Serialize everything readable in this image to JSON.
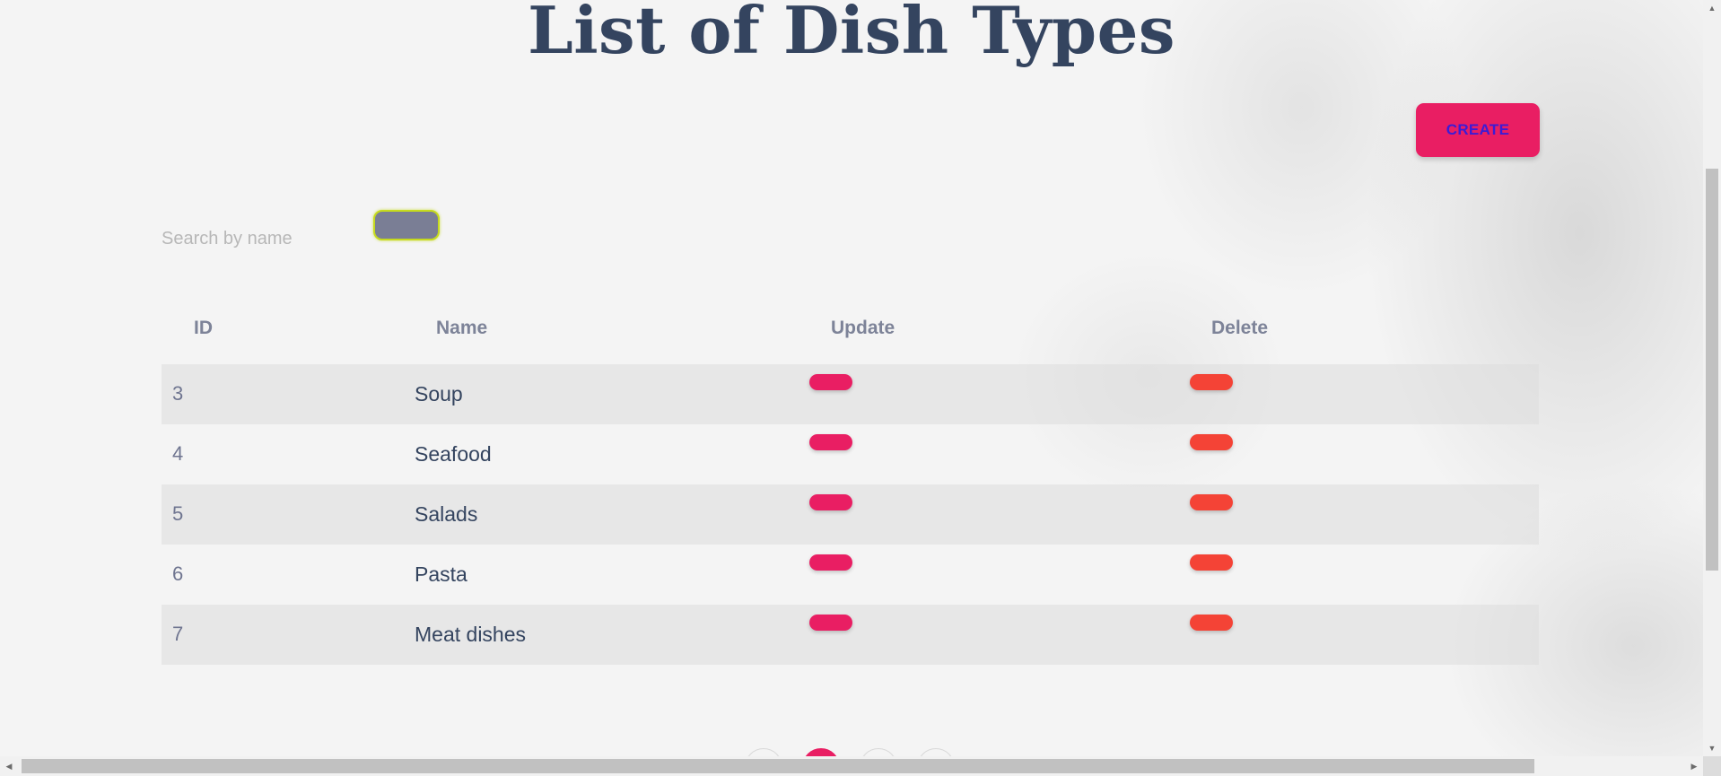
{
  "page": {
    "title": "List of Dish Types"
  },
  "toolbar": {
    "create_label": "CREATE"
  },
  "search": {
    "placeholder": "Search by name",
    "value": ""
  },
  "table": {
    "headers": {
      "id": "ID",
      "name": "Name",
      "update": "Update",
      "delete": "Delete"
    },
    "rows": [
      {
        "id": "3",
        "name": "Soup"
      },
      {
        "id": "4",
        "name": "Seafood"
      },
      {
        "id": "5",
        "name": "Salads"
      },
      {
        "id": "6",
        "name": "Pasta"
      },
      {
        "id": "7",
        "name": "Meat dishes"
      }
    ]
  },
  "colors": {
    "title": "#34445f",
    "primary": "#e91e63",
    "delete": "#f44336",
    "create_text": "#3b1cd6",
    "search_button": "#7a7e95",
    "search_button_border": "#c6da1e"
  },
  "pagination": {
    "active_index": 1,
    "pages_visible": 4
  }
}
